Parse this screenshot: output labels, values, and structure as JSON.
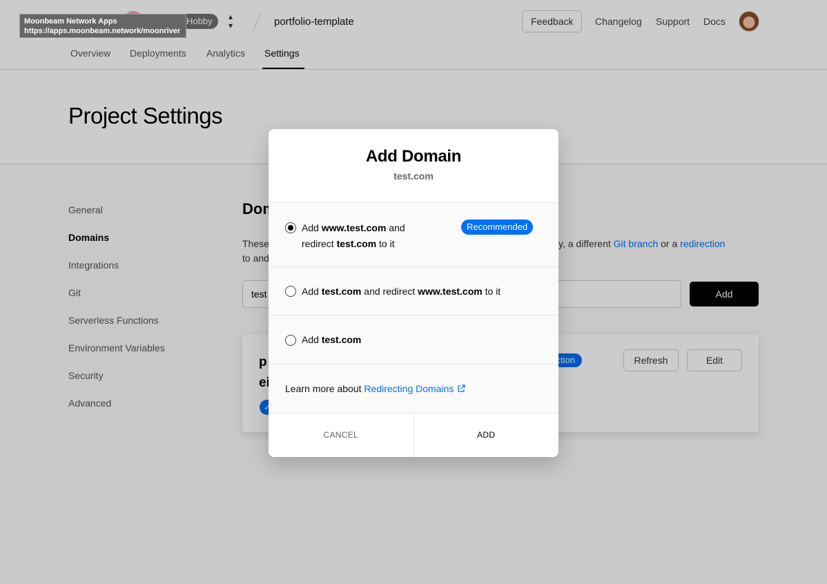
{
  "topbar": {
    "logo": "▲",
    "plan": "Hobby",
    "project": "portfolio-template",
    "feedback": "Feedback",
    "links": [
      "Changelog",
      "Support",
      "Docs"
    ]
  },
  "tabs": [
    "Overview",
    "Deployments",
    "Analytics",
    "Settings"
  ],
  "page_title": "Project Settings",
  "sidebar": [
    "General",
    "Domains",
    "Integrations",
    "Git",
    "Serverless Functions",
    "Environment Variables",
    "Security",
    "Advanced"
  ],
  "domains_section": {
    "title": "Dom",
    "desc_start": "These",
    "desc_mid": "ally, a different",
    "git_branch_link": "Git branch",
    "or_a": "or a",
    "redirection_link": "redirection",
    "desc_line2": "to and",
    "input_value": "test",
    "add_button": "Add",
    "card": {
      "name_line1": "p",
      "name_line2": "ei",
      "badge": "duction",
      "refresh": "Refresh",
      "edit": "Edit"
    }
  },
  "modal": {
    "title": "Add Domain",
    "subtitle": "test.com",
    "option1": {
      "pre": "Add",
      "www": "www.test.com",
      "mid": "and redirect",
      "root": "test.com",
      "post": "to it",
      "badge": "Recommended"
    },
    "option2": {
      "pre": "Add",
      "root": "test.com",
      "mid": "and redirect",
      "www": "www.test.com",
      "post": "to it"
    },
    "option3": {
      "pre": "Add",
      "root": "test.com"
    },
    "learn_text": "Learn more about",
    "learn_link": "Redirecting Domains",
    "cancel": "CANCEL",
    "confirm": "ADD"
  },
  "tooltip": {
    "title": "Moonbeam Network Apps",
    "url": "https://apps.moonbeam.network/moonriver"
  },
  "colors": {
    "accent": "#0070f3",
    "primary_button": "#000000"
  }
}
